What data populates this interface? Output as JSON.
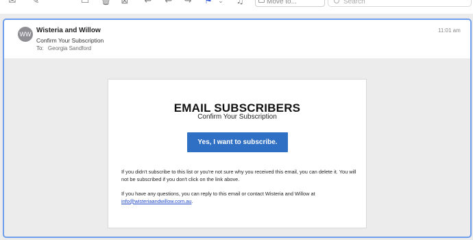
{
  "toolbar": {
    "icons": [
      "inbox-icon",
      "compose-icon",
      "archive-icon",
      "trash-icon",
      "junk-icon",
      "reply-icon",
      "reply-all-icon",
      "forward-icon",
      "flag-icon",
      "chevron-down-icon",
      "bell-icon",
      "folder-icon",
      "search-icon"
    ],
    "move_label": "Move to...",
    "search_placeholder": "Search",
    "flag_color": "#3b5bd6"
  },
  "message": {
    "avatar_initials": "WW",
    "sender": "Wisteria and Willow",
    "subject": "Confirm Your Subscription",
    "to_label": "To:",
    "to_name": "Georgia Sandford",
    "time": "11:01 am"
  },
  "email": {
    "title": "EMAIL SUBSCRIBERS",
    "subtitle": "Confirm Your Subscription",
    "button_label": "Yes, I want to subscribe.",
    "button_color": "#2f6fc4",
    "para1": "If you didn't subscribe to this list or you're not sure why you received this email, you can delete it. You will not be subscribed if you don't click on the link above.",
    "para2_text": "If you have any questions, you can reply to this email or contact Wisteria and Willow at",
    "contact_email": "info@wisteriaandwillow.com.au",
    "para2_end": "."
  },
  "colors": {
    "selection_border": "#6d9eeb",
    "background": "#ececec"
  }
}
